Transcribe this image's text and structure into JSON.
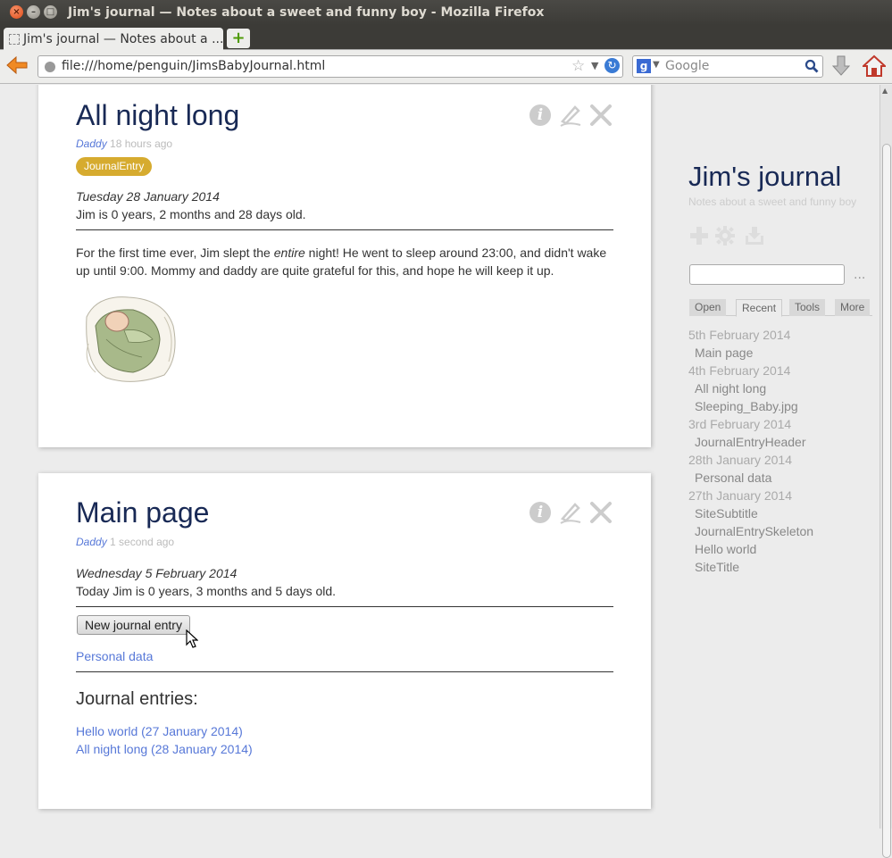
{
  "window": {
    "title": "Jim's journal — Notes about a sweet and funny boy - Mozilla Firefox",
    "close_glyph": "×",
    "min_glyph": "–",
    "max_glyph": "□"
  },
  "tabs": [
    {
      "label": "Jim's journal — Notes about a ..."
    }
  ],
  "newtab_glyph": "+",
  "nav": {
    "url": "file:///home/penguin/JimsBabyJournal.html",
    "search_placeholder": "Google",
    "search_engine_glyph": "g"
  },
  "tiddlers": [
    {
      "title": "All night long",
      "author": "Daddy",
      "time": "18 hours ago",
      "tag": "JournalEntry",
      "date": "Tuesday 28 January 2014",
      "age": "Jim is 0 years, 2 months and 28 days old.",
      "paragraph": {
        "before": "For the first time ever, Jim slept the ",
        "emph": "entire",
        "after": " night! He went to sleep around 23:00, and didn't wake up until 9:00. Mommy and daddy are quite grateful for this, and hope he will keep it up."
      },
      "image_icon": "sleeping-baby-illustration"
    },
    {
      "title": "Main page",
      "author": "Daddy",
      "time": "1 second ago",
      "date": "Wednesday 5 February 2014",
      "age": "Today Jim is 0 years, 3 months and 5 days old.",
      "button": "New journal entry",
      "link": "Personal data",
      "heading": "Journal entries:",
      "entries": [
        "Hello world (27 January 2014)",
        "All night long (28 January 2014)"
      ]
    }
  ],
  "sidebar": {
    "title": "Jim's journal",
    "subtitle": "Notes about a sweet and funny boy",
    "more_glyph": "...",
    "tabs": [
      "Open",
      "Recent",
      "Tools",
      "More"
    ],
    "active_tab": "Recent",
    "recent": [
      {
        "date": "5th February 2014",
        "items": [
          "Main page"
        ]
      },
      {
        "date": "4th February 2014",
        "items": [
          "All night long",
          "Sleeping_Baby.jpg"
        ]
      },
      {
        "date": "3rd February 2014",
        "items": [
          "JournalEntryHeader"
        ]
      },
      {
        "date": "28th January 2014",
        "items": [
          "Personal data"
        ]
      },
      {
        "date": "27th January 2014",
        "items": [
          "SiteSubtitle",
          "JournalEntrySkeleton",
          "Hello world",
          "SiteTitle"
        ]
      }
    ]
  },
  "colors": {
    "title": "#182955",
    "link": "#5778d8",
    "tag": "#d6ab2f"
  }
}
